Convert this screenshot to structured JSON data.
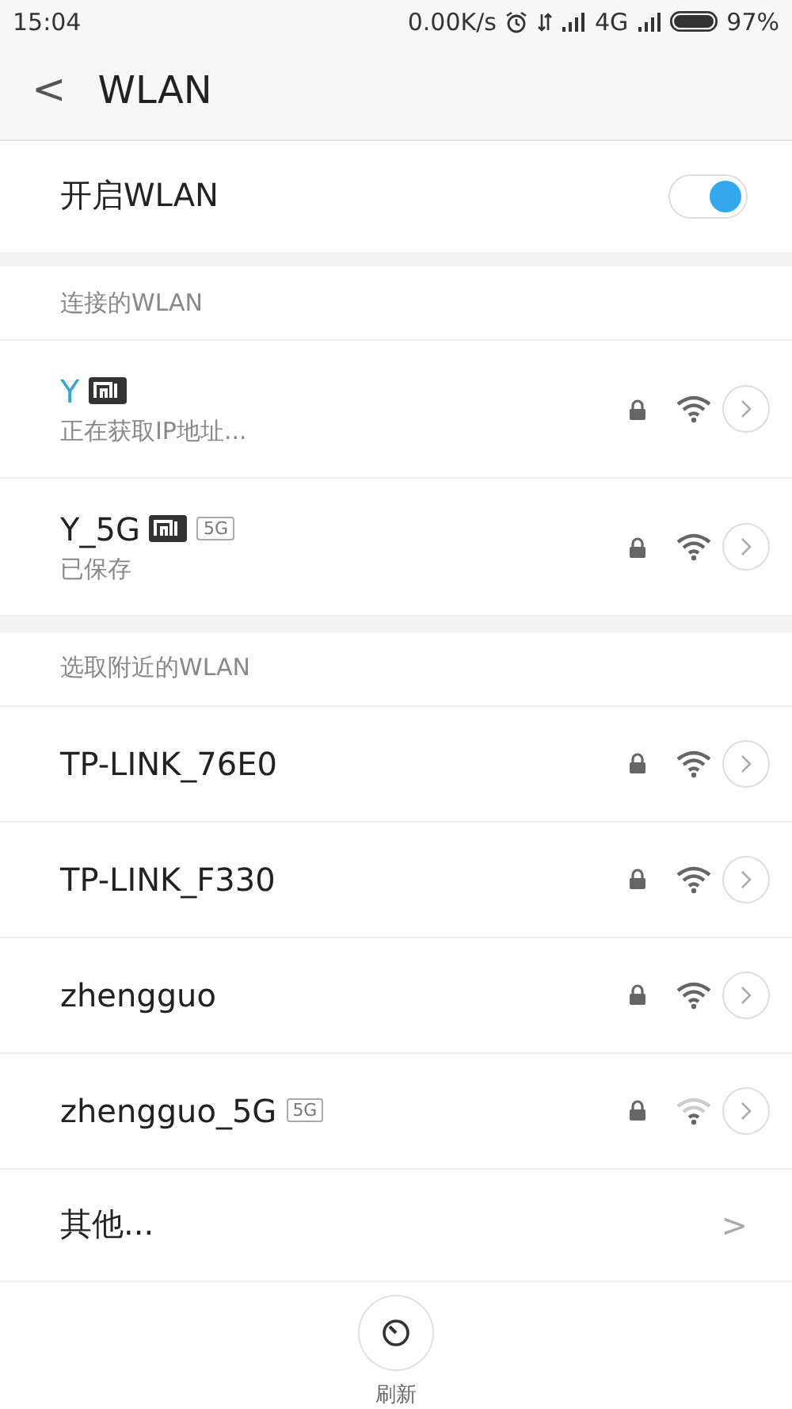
{
  "status_bar": {
    "time": "15:04",
    "speed": "0.00K/s",
    "network": "4G",
    "battery": "97%"
  },
  "header": {
    "back": "<",
    "title": "WLAN"
  },
  "toggle": {
    "label": "开启WLAN",
    "on": true
  },
  "sections": [
    {
      "title": "连接的WLAN",
      "networks": [
        {
          "name": "Y",
          "status": "正在获取IP地址...",
          "connecting": true,
          "mi": true,
          "locked": true,
          "weak": false
        },
        {
          "name": "Y_5G",
          "status": "已保存",
          "connecting": false,
          "mi": true,
          "band": "5G",
          "locked": true,
          "weak": false
        }
      ]
    },
    {
      "title": "选取附近的WLAN",
      "networks": [
        {
          "name": "TP-LINK_76E0",
          "connecting": false,
          "mi": false,
          "locked": true,
          "weak": false
        },
        {
          "name": "TP-LINK_F330",
          "connecting": false,
          "mi": false,
          "locked": true,
          "weak": false
        },
        {
          "name": "zhengguo",
          "connecting": false,
          "mi": false,
          "locked": true,
          "weak": false
        },
        {
          "name": "zhengguo_5G",
          "connecting": false,
          "mi": false,
          "band": "5G",
          "locked": true,
          "weak": true
        }
      ]
    }
  ],
  "other": {
    "label": "其他...",
    "arrow": ">"
  },
  "refresh": {
    "label": "刷新"
  }
}
